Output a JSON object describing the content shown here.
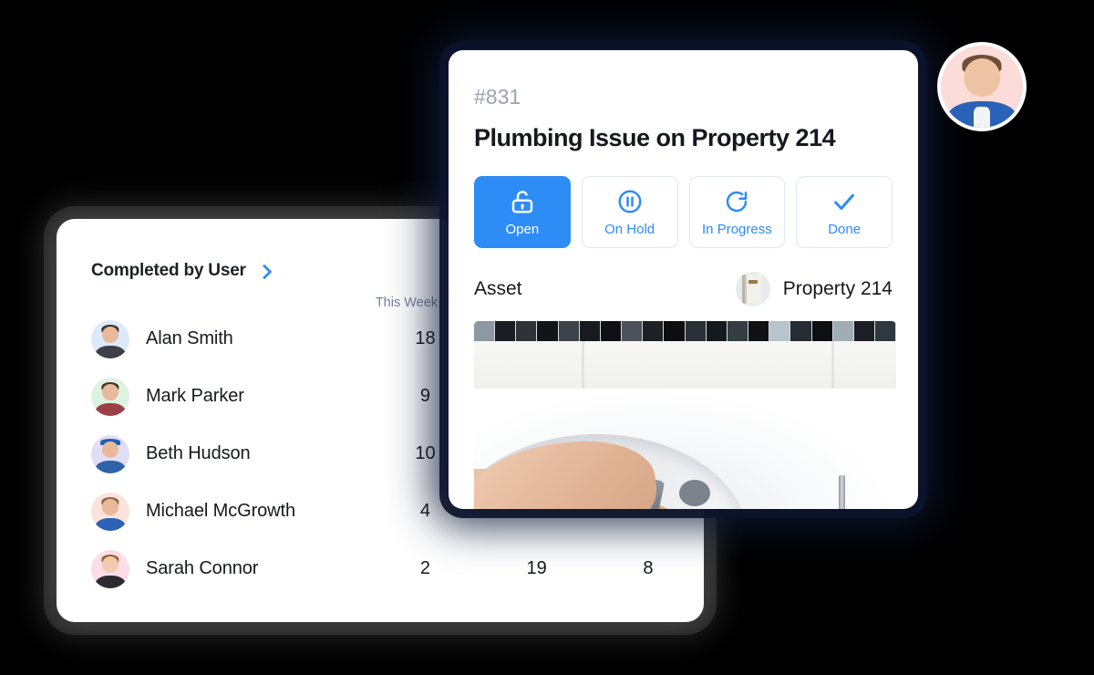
{
  "background_color": "#000000",
  "accent_color": "#2e8cf7",
  "stats_panel": {
    "title": "Completed by User",
    "expand_icon": "chevron-right-icon",
    "columns": [
      "This Week",
      "",
      ""
    ],
    "rows": [
      {
        "name": "Alan Smith",
        "avatar": "avatar-alan-smith",
        "avatar_bg": "#dbeafb",
        "values": [
          "18",
          "",
          ""
        ]
      },
      {
        "name": "Mark Parker",
        "avatar": "avatar-mark-parker",
        "avatar_bg": "#ddf3e2",
        "values": [
          "9",
          "",
          ""
        ]
      },
      {
        "name": "Beth Hudson",
        "avatar": "avatar-beth-hudson",
        "avatar_bg": "#e2ddf7",
        "values": [
          "10",
          "",
          ""
        ]
      },
      {
        "name": "Michael McGrowth",
        "avatar": "avatar-michael-mcgrowth",
        "avatar_bg": "#fbe2da",
        "values": [
          "4",
          "",
          ""
        ]
      },
      {
        "name": "Sarah Connor",
        "avatar": "avatar-sarah-connor",
        "avatar_bg": "#fbdde8",
        "values": [
          "2",
          "19",
          "8"
        ]
      }
    ]
  },
  "ticket_card": {
    "id": "#831",
    "title": "Plumbing Issue on Property 214",
    "statuses": [
      {
        "label": "Open",
        "icon": "unlock-icon",
        "active": true
      },
      {
        "label": "On Hold",
        "icon": "pause-circle-icon",
        "active": false
      },
      {
        "label": "In Progress",
        "icon": "refresh-icon",
        "active": false
      },
      {
        "label": "Done",
        "icon": "check-icon",
        "active": false
      }
    ],
    "asset": {
      "label": "Asset",
      "thumbnail": "door-thumbnail",
      "value": "Property  214"
    },
    "photo": {
      "name": "plumbing-repair-photo",
      "alt": "Hand repairing a faucet on a white bathroom sink with a braided hose and a yellow screwdriver"
    }
  },
  "floating_avatar": {
    "name": "technician-avatar",
    "bg": "#fbdcd8"
  }
}
